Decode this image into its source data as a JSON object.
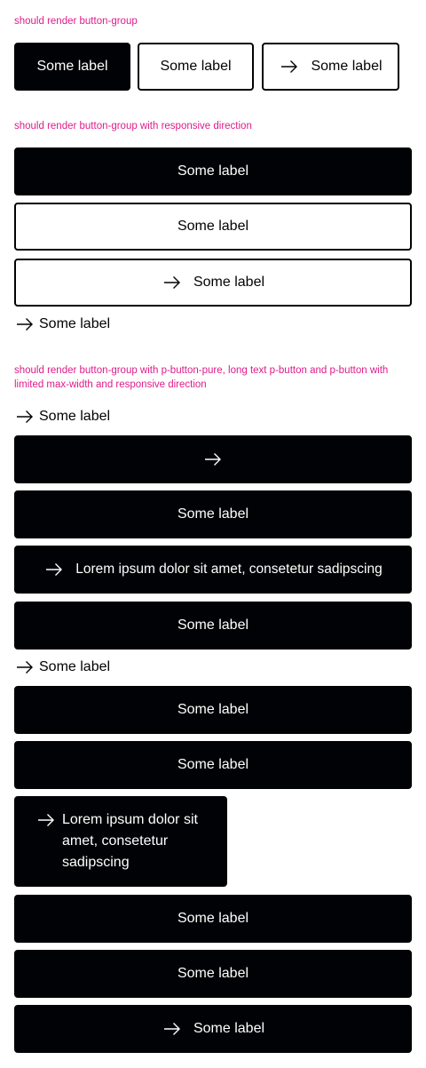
{
  "sections": [
    {
      "heading": "should render button-group",
      "buttons": [
        {
          "label": "Some label",
          "variant": "primary"
        },
        {
          "label": "Some label",
          "variant": "secondary"
        },
        {
          "label": "Some label",
          "variant": "secondary",
          "icon": "arrow-right-icon"
        }
      ]
    },
    {
      "heading": "should render button-group with responsive direction",
      "buttons": [
        {
          "label": "Some label",
          "variant": "primary"
        },
        {
          "label": "Some label",
          "variant": "secondary"
        },
        {
          "label": "Some label",
          "variant": "secondary",
          "icon": "arrow-right-icon"
        },
        {
          "label": "Some label",
          "variant": "pure",
          "icon": "arrow-right-icon"
        }
      ]
    },
    {
      "heading": "should render button-group with p-button-pure, long text p-button and p-button with limited max-width and responsive direction",
      "buttons": [
        {
          "label": "Some label",
          "variant": "pure",
          "icon": "arrow-right-icon"
        },
        {
          "label": "",
          "variant": "primary",
          "icon": "arrow-right-icon"
        },
        {
          "label": "Some label",
          "variant": "primary"
        },
        {
          "label": "Lorem ipsum dolor sit amet, consetetur sadipscing",
          "variant": "primary",
          "icon": "arrow-right-icon"
        },
        {
          "label": "Some label",
          "variant": "primary"
        },
        {
          "label": "Some label",
          "variant": "pure",
          "icon": "arrow-right-icon"
        },
        {
          "label": "Some label",
          "variant": "primary"
        },
        {
          "label": "Some label",
          "variant": "primary"
        },
        {
          "label": "Lorem ipsum dolor sit amet, consetetur sadipscing",
          "variant": "primary",
          "icon": "arrow-right-icon"
        },
        {
          "label": "Some label",
          "variant": "primary"
        },
        {
          "label": "Some label",
          "variant": "primary"
        },
        {
          "label": "Some label",
          "variant": "primary",
          "icon": "arrow-right-icon"
        }
      ]
    }
  ],
  "colors": {
    "accent": "#de1b89",
    "primary": "#010205",
    "background": "#ffffff"
  }
}
